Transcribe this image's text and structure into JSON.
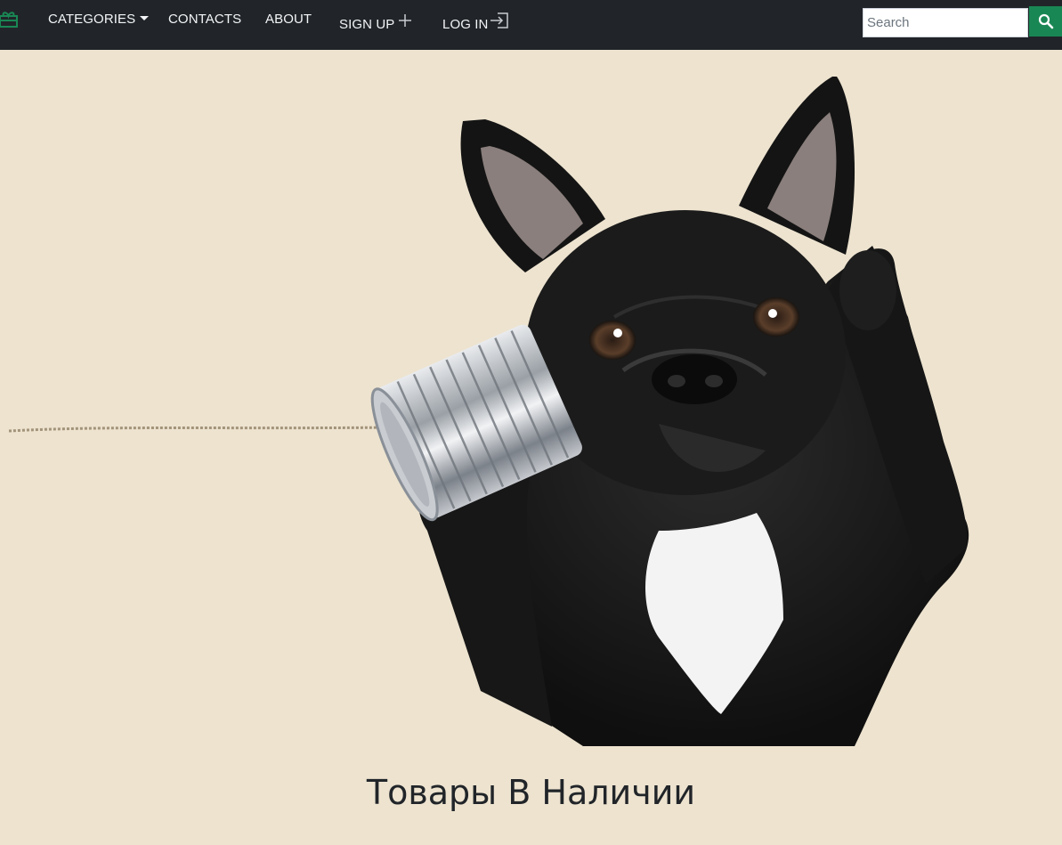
{
  "navbar": {
    "brand_icon": "gift-icon",
    "brand_color": "#198754",
    "background": "#212529",
    "items": {
      "categories": "CATEGORIES",
      "contacts": "CONTACTS",
      "about": "ABOUT",
      "signup": "SIGN UP",
      "login": "LOG IN"
    },
    "signup_icon": "plus-icon",
    "login_icon": "login-icon"
  },
  "search": {
    "placeholder": "Search",
    "value": "",
    "button_icon": "search-icon",
    "button_color": "#198754"
  },
  "hero": {
    "image": "french-bulldog-tin-can-phone",
    "background": "#ede3cf"
  },
  "main": {
    "heading": "Товары В Наличии"
  }
}
